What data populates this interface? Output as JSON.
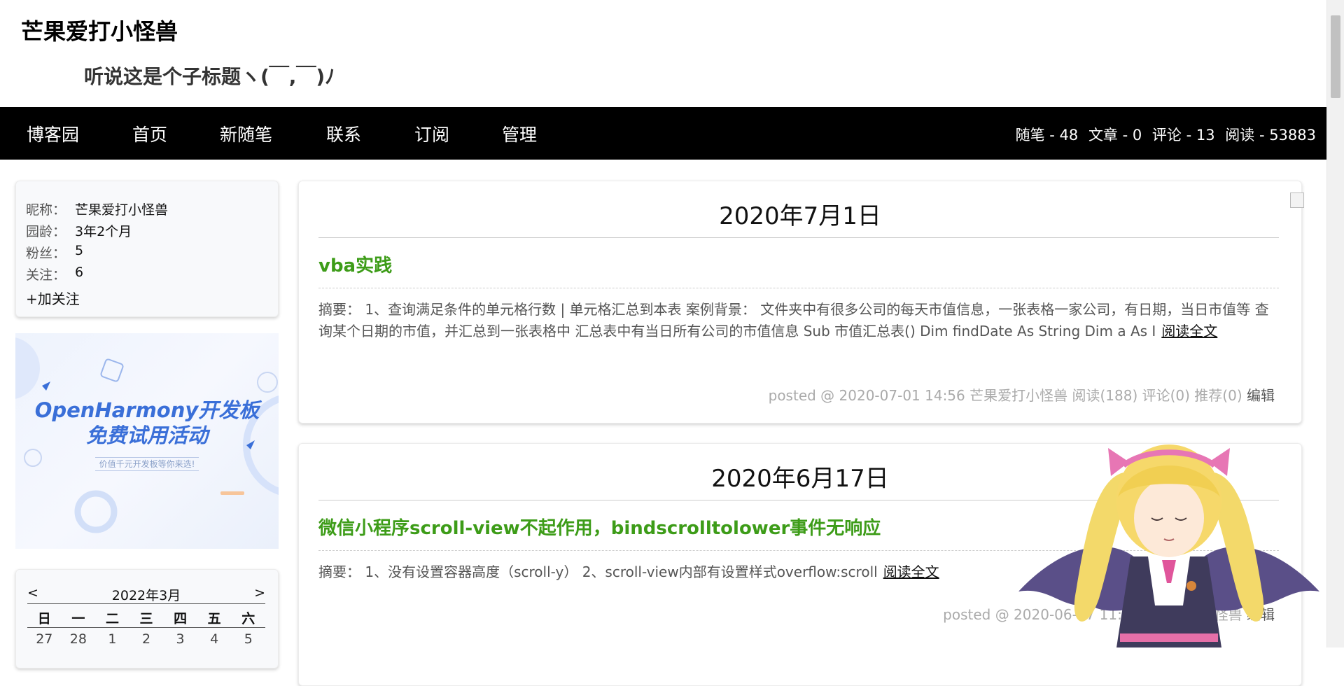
{
  "header": {
    "title": "芒果爱打小怪兽",
    "subtitle": "听说这是个子标题ヽ(￣,￣)ﾉ"
  },
  "nav": {
    "items": [
      "博客园",
      "首页",
      "新随笔",
      "联系",
      "订阅",
      "管理"
    ],
    "stats": {
      "posts": "随笔 - 48",
      "articles": "文章 - 0",
      "comments": "评论 - 13",
      "reads": "阅读 - 53883"
    }
  },
  "profile": {
    "rows": [
      {
        "label": "昵称：",
        "value": "芒果爱打小怪兽"
      },
      {
        "label": "园龄：",
        "value": "3年2个月"
      },
      {
        "label": "粉丝：",
        "value": "5"
      },
      {
        "label": "关注：",
        "value": "6"
      }
    ],
    "follow": "+加关注"
  },
  "ad": {
    "title_line1": "OpenHarmony开发板",
    "title_line2": "免费试用活动",
    "subtitle": "价值千元开发板等你来选!"
  },
  "calendar": {
    "prev": "<",
    "title": "2022年3月",
    "next": ">",
    "weekdays": [
      "日",
      "一",
      "二",
      "三",
      "四",
      "五",
      "六"
    ],
    "first_row": [
      "27",
      "28",
      "1",
      "2",
      "3",
      "4",
      "5"
    ]
  },
  "posts": [
    {
      "date": "2020年7月1日",
      "title": "vba实践",
      "summary": "摘要： 1、查询满足条件的单元格行数 | 单元格汇总到本表 案例背景： 文件夹中有很多公司的每天市值信息，一张表格一家公司，有日期，当日市值等 查询某个日期的市值，并汇总到一张表格中 汇总表中有当日所有公司的市值信息 Sub 市值汇总表() Dim findDate As String Dim a As I",
      "read_more": "阅读全文",
      "meta": "posted @ 2020-07-01 14:56 芒果爱打小怪兽 阅读(188) 评论(0) 推荐(0)",
      "edit": "编辑"
    },
    {
      "date": "2020年6月17日",
      "title": "微信小程序scroll-view不起作用，bindscrolltolower事件无响应",
      "summary": "摘要： 1、没有设置容器高度（scroll-y） 2、scroll-view内部有设置样式overflow:scroll",
      "read_more": "阅读全文",
      "meta": "posted @ 2020-06-17 11:46 芒果爱打小怪兽",
      "edit": "编辑"
    }
  ]
}
